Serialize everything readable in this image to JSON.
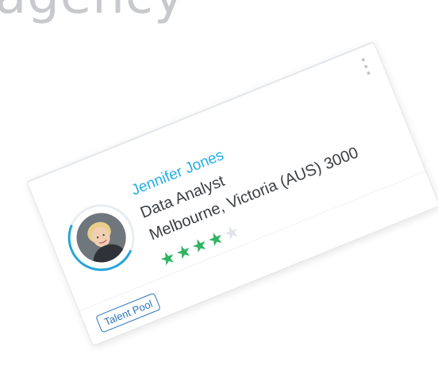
{
  "background": {
    "heading": "agency"
  },
  "card": {
    "name": "Jennifer Jones",
    "job_title": "Data Analyst",
    "location": "Melbourne, Victoria (AUS) 3000",
    "rating": 4,
    "rating_max": 5,
    "badge": "Talent Pool",
    "menu_icon": "kebab-menu-icon",
    "colors": {
      "name": "#23aee6",
      "stars": "#2fb562",
      "badge": "#2a73b9",
      "ring": "#26a5d9"
    }
  }
}
